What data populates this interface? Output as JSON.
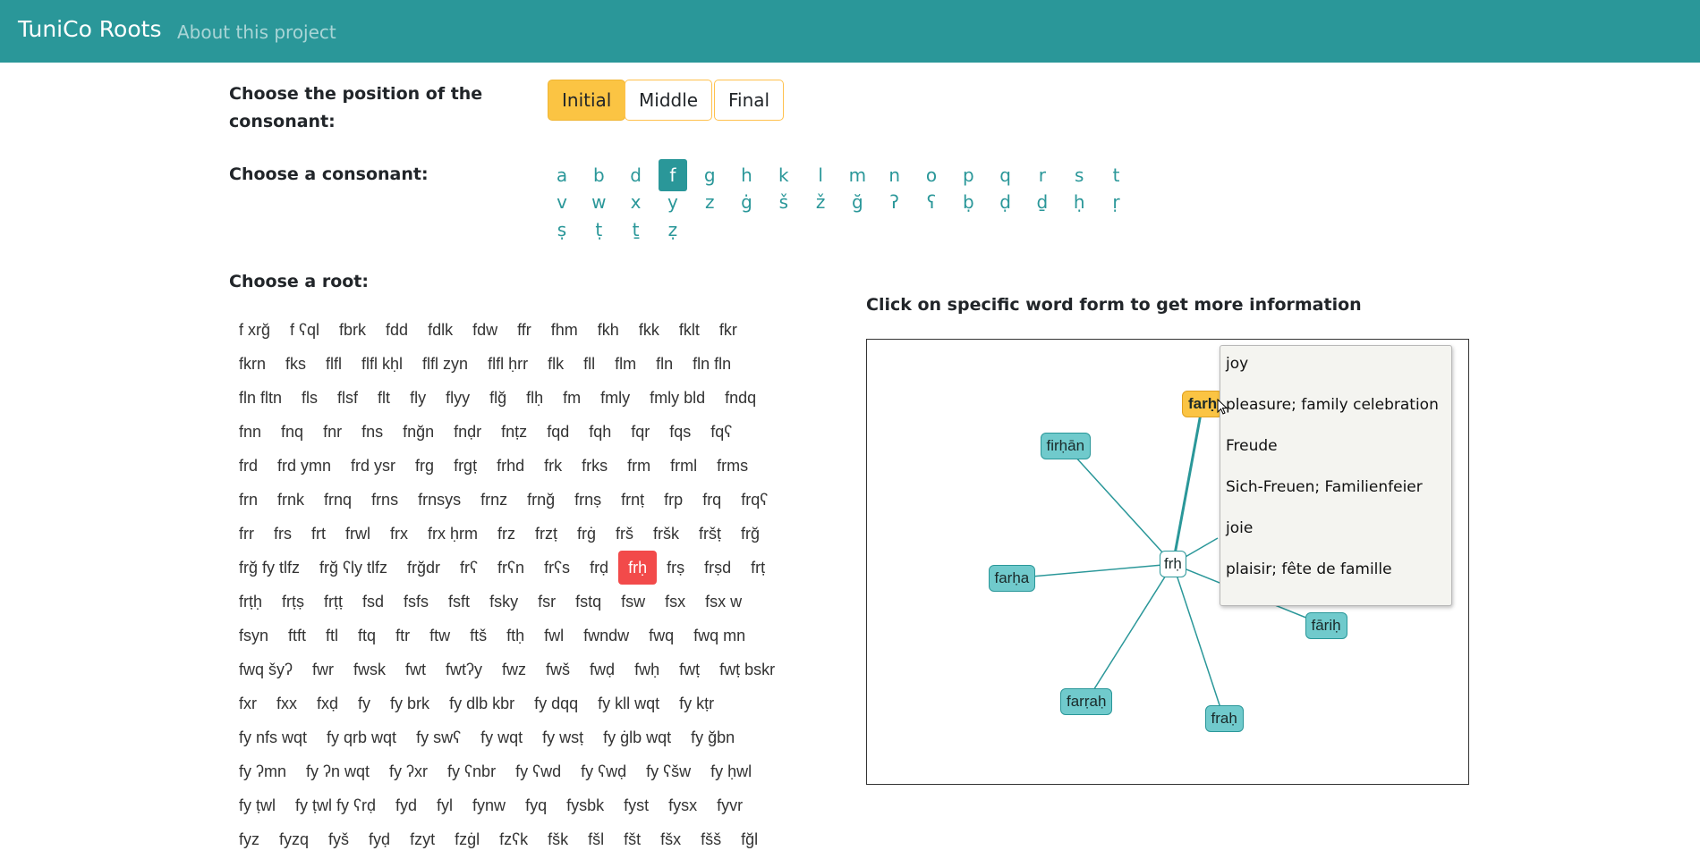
{
  "navbar": {
    "brand": "TuniCo Roots",
    "link": "About this project"
  },
  "position": {
    "label": "Choose the position of the consonant:",
    "options": [
      "Initial",
      "Middle",
      "Final"
    ],
    "active": "Initial"
  },
  "consonant": {
    "label": "Choose a consonant:",
    "rows": [
      [
        "a",
        "b",
        "d",
        "f",
        "g",
        "h",
        "k",
        "l",
        "m",
        "n",
        "o",
        "p",
        "q",
        "r",
        "s",
        "t"
      ],
      [
        "v",
        "w",
        "x",
        "y",
        "z",
        "ġ",
        "š",
        "ž",
        "ğ",
        "ʔ",
        "ʕ",
        "ḅ",
        "ḍ",
        "ḏ",
        "ḥ",
        "ṛ"
      ],
      [
        "ṣ",
        "ṭ",
        "ṯ",
        "ẓ"
      ]
    ],
    "active": "f"
  },
  "roots": {
    "label": "Choose a root:",
    "rows": [
      [
        "f xrğ",
        "f ʕql",
        "fbrk",
        "fdd",
        "fdlk",
        "fdw",
        "ffr",
        "fhm",
        "fkh",
        "fkk",
        "fklt",
        "fkr"
      ],
      [
        "fkrn",
        "fks",
        "flfl",
        "flfl kḥl",
        "flfl zyn",
        "flfl ḥrr",
        "flk",
        "fll",
        "flm",
        "fln",
        "fln fln"
      ],
      [
        "fln fltn",
        "fls",
        "flsf",
        "flt",
        "fly",
        "flyy",
        "flğ",
        "flḥ",
        "fm",
        "fmly",
        "fmly bld",
        "fndq"
      ],
      [
        "fnn",
        "fnq",
        "fnr",
        "fns",
        "fnğn",
        "fnḍr",
        "fnṭz",
        "fqd",
        "fqh",
        "fqr",
        "fqs",
        "fqʕ"
      ],
      [
        "frd",
        "frd ymn",
        "frd ysr",
        "frg",
        "frgṭ",
        "frhd",
        "frk",
        "frks",
        "frm",
        "frml",
        "frms"
      ],
      [
        "frn",
        "frnk",
        "frnq",
        "frns",
        "frnsys",
        "frnz",
        "frnğ",
        "frnṣ",
        "frnṭ",
        "frp",
        "frq",
        "frqʕ"
      ],
      [
        "frr",
        "frs",
        "frt",
        "frwl",
        "frx",
        "frx ḥrm",
        "frz",
        "frzṭ",
        "frġ",
        "frš",
        "fršk",
        "fršṭ",
        "frğ"
      ],
      [
        "frğ fy tlfz",
        "frğ ʕly tlfz",
        "frğdr",
        "frʕ",
        "frʕn",
        "frʕs",
        "frḍ",
        "frḥ",
        "frṣ",
        "frṣd",
        "frṭ"
      ],
      [
        "frṭḥ",
        "frṭṣ",
        "frṭṭ",
        "fsd",
        "fsfs",
        "fsft",
        "fsky",
        "fsr",
        "fstq",
        "fsw",
        "fsx",
        "fsx w"
      ],
      [
        "fsyn",
        "ftft",
        "ftl",
        "ftq",
        "ftr",
        "ftw",
        "ftš",
        "ftḥ",
        "fwl",
        "fwndw",
        "fwq",
        "fwq mn"
      ],
      [
        "fwq šyʔ",
        "fwr",
        "fwsk",
        "fwt",
        "fwtʔy",
        "fwz",
        "fwš",
        "fwḍ",
        "fwḥ",
        "fwṭ",
        "fwṭ bskr"
      ],
      [
        "fxr",
        "fxx",
        "fxḍ",
        "fy",
        "fy brk",
        "fy dlb kbr",
        "fy dqq",
        "fy kll wqt",
        "fy kṭr"
      ],
      [
        "fy nfs wqt",
        "fy qrb wqt",
        "fy swʕ",
        "fy wqt",
        "fy wsṭ",
        "fy ġlb wqt",
        "fy ğbn"
      ],
      [
        "fy ʔmn",
        "fy ʔn wqt",
        "fy ʔxr",
        "fy ʕnbr",
        "fy ʕwd",
        "fy ʕwḍ",
        "fy ʕšw",
        "fy ḥwl"
      ],
      [
        "fy ṭwl",
        "fy ṭwl fy ʕrḍ",
        "fyd",
        "fyl",
        "fynw",
        "fyq",
        "fysbk",
        "fyst",
        "fysx",
        "fyvr"
      ],
      [
        "fyz",
        "fyzq",
        "fyš",
        "fyḍ",
        "fzyt",
        "fzġl",
        "fzʕk",
        "fšk",
        "fšl",
        "fšt",
        "fšx",
        "fšš",
        "fğl"
      ]
    ],
    "selected": "frḥ"
  },
  "graph": {
    "title": "Click on specific word form to get more information",
    "center": "frḥ",
    "nodes": [
      "farḥ",
      "firḥān",
      "farḥa",
      "farṛaḥ",
      "fraḥ",
      "fāriḥ"
    ],
    "selected": "farḥ",
    "edge_color": "#2a9799",
    "node_color": "#70cacc",
    "selected_color": "#fbc443"
  },
  "tooltip": {
    "lines": [
      "joy",
      "pleasure; family celebration",
      "Freude",
      "Sich-Freuen; Familienfeier",
      "joie",
      "plaisir; fête de famille"
    ]
  }
}
